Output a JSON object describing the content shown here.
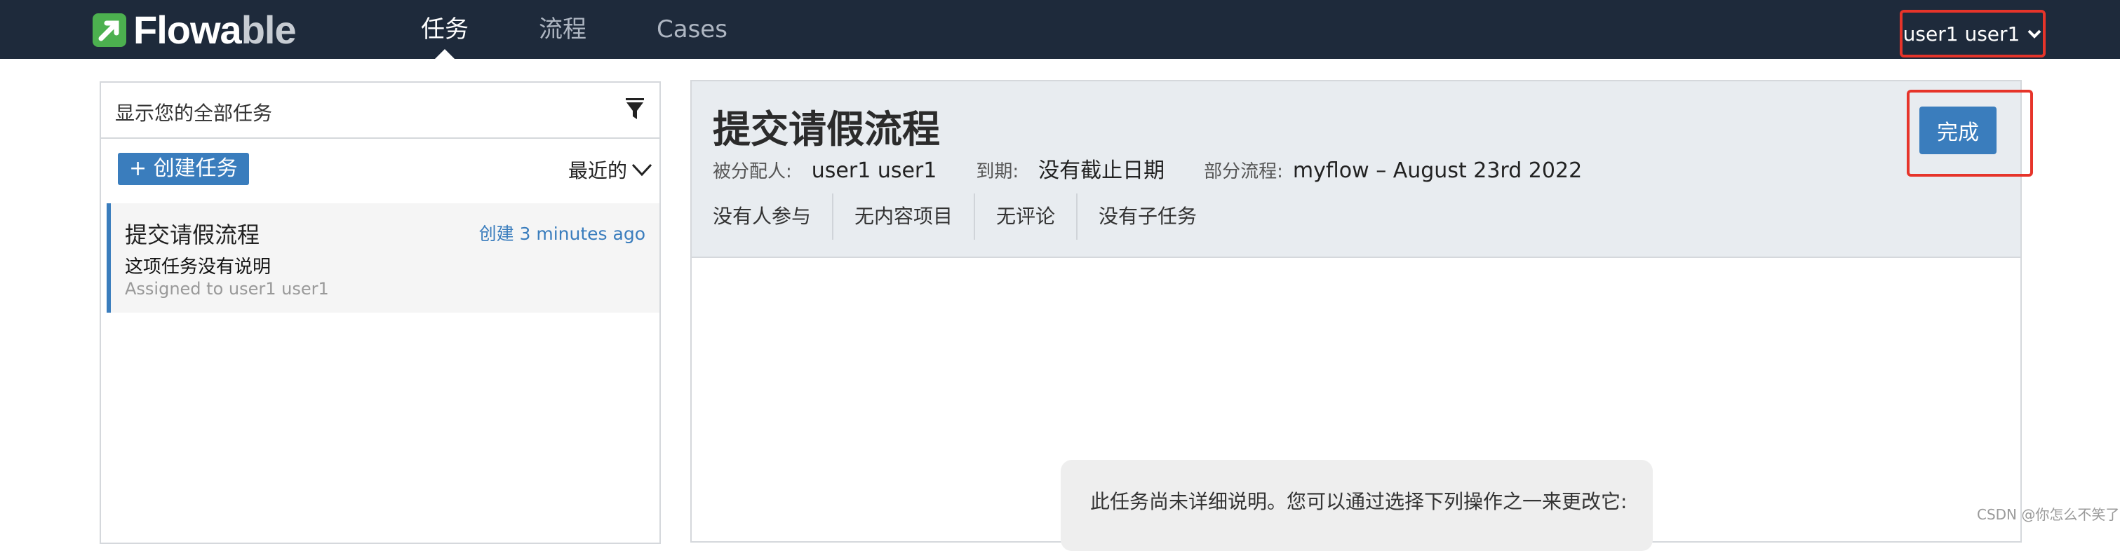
{
  "app": {
    "logo_prefix": "Flowa",
    "logo_suffix": "ble"
  },
  "nav": {
    "tabs": [
      {
        "label": "任务",
        "active": true
      },
      {
        "label": "流程",
        "active": false
      },
      {
        "label": "Cases",
        "active": false
      }
    ],
    "user_label": "user1 user1"
  },
  "task_list": {
    "filter_text": "显示您的全部任务",
    "create_label": "+ 创建任务",
    "sort_label": "最近的",
    "items": [
      {
        "title": "提交请假流程",
        "created": "创建 3 minutes ago",
        "description": "这项任务没有说明",
        "assigned": "Assigned to user1 user1"
      }
    ]
  },
  "detail": {
    "title": "提交请假流程",
    "assignee_label": "被分配人:",
    "assignee": "user1 user1",
    "due_label": "到期:",
    "due": "没有截止日期",
    "process_label": "部分流程:",
    "process": "myflow – August 23rd 2022",
    "complete_label": "完成",
    "sub_tabs": [
      "没有人参与",
      "无内容项目",
      "无评论",
      "没有子任务"
    ],
    "empty_hint": "此任务尚未详细说明。您可以通过选择下列操作之一来更改它:"
  },
  "watermark": "CSDN @你怎么不笑了",
  "colors": {
    "nav_bg": "#1e2a3b",
    "accent": "#3a7dbd",
    "logo_green": "#4cb04f",
    "highlight_red": "#e6342a",
    "header_bg": "#e8ecf0"
  }
}
